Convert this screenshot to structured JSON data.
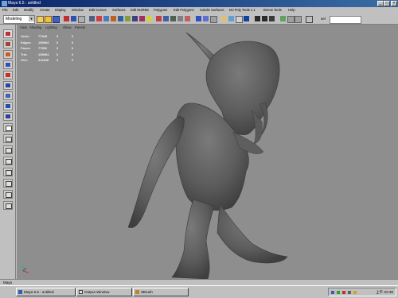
{
  "window": {
    "title": "Maya 6.5 : untitled",
    "controls": [
      "_",
      "□",
      "×"
    ]
  },
  "menubar": {
    "items": [
      "File",
      "Edit",
      "Modify",
      "Create",
      "Display",
      "Window",
      "Edit Curves",
      "Surfaces",
      "Edit NURBS",
      "Polygons",
      "Edit Polygons",
      "Subdiv Surfaces",
      "MJ Poly Tools 1.1",
      "Bonus Tools",
      "Help"
    ]
  },
  "toolbar": {
    "mode": "Modeling",
    "field_label": "sel"
  },
  "panel_menu": {
    "items": [
      "View",
      "Shading",
      "Lighting",
      "Show",
      "Panels"
    ]
  },
  "hud": {
    "rows": [
      {
        "label": "Verts:",
        "values": [
          "77945",
          "0",
          "0"
        ]
      },
      {
        "label": "Edges:",
        "values": [
          "155904",
          "0",
          "0"
        ]
      },
      {
        "label": "Faces:",
        "values": [
          "77952",
          "0",
          "0"
        ]
      },
      {
        "label": "Tris:",
        "values": [
          "155904",
          "0",
          "0"
        ]
      },
      {
        "label": "UVs:",
        "values": [
          "311808",
          "0",
          "0"
        ]
      }
    ]
  },
  "taskbar": {
    "tasks": [
      "Maya 6.5 : untitled",
      "Output Window",
      "ZBrush"
    ],
    "start_label": "Maya",
    "clock": "上午 02:39"
  },
  "colors": {
    "viewport_bg": "#8e8e8e",
    "model": "#5f5f5f",
    "titlebar": "#0a246a"
  }
}
